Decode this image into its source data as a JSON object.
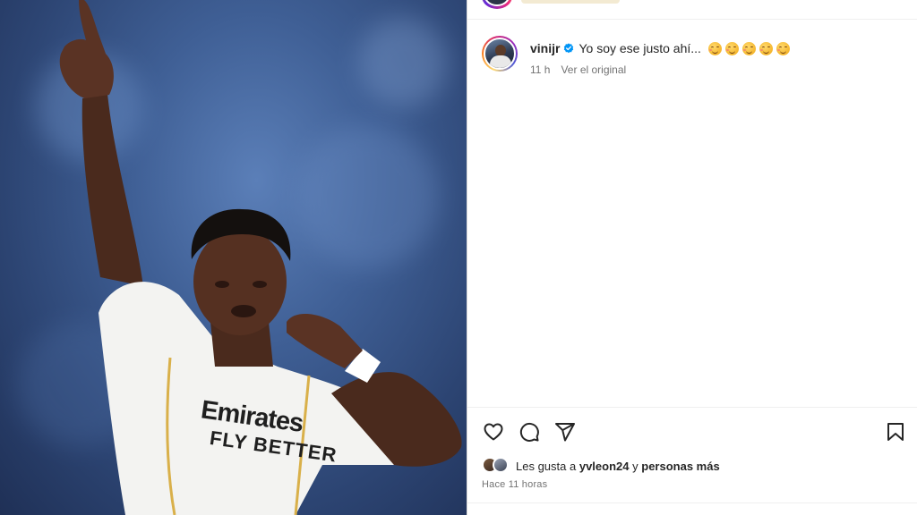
{
  "post": {
    "image": {
      "description": "",
      "shirt_sponsor_line1": "Emirates",
      "shirt_sponsor_line2": "FLY BETTER"
    }
  },
  "comment": {
    "username": "vinijr",
    "verified": true,
    "caption": "Yo soy ese justo ahí...",
    "emoji_count": 5,
    "emoji_name": "smiling-face-icon",
    "time": "11 h",
    "see_original": "Ver el original"
  },
  "actions": {
    "like_icon": "heart-icon",
    "comment_icon": "comment-icon",
    "share_icon": "share-icon",
    "save_icon": "bookmark-icon"
  },
  "likes": {
    "prefix": "Les gusta a",
    "user": "yvleon24",
    "connector": "y",
    "others": "personas más"
  },
  "timestamp": "Hace 11 horas",
  "colors": {
    "accent_blue": "#0095f6",
    "text": "#262626",
    "secondary_text": "#737373"
  }
}
